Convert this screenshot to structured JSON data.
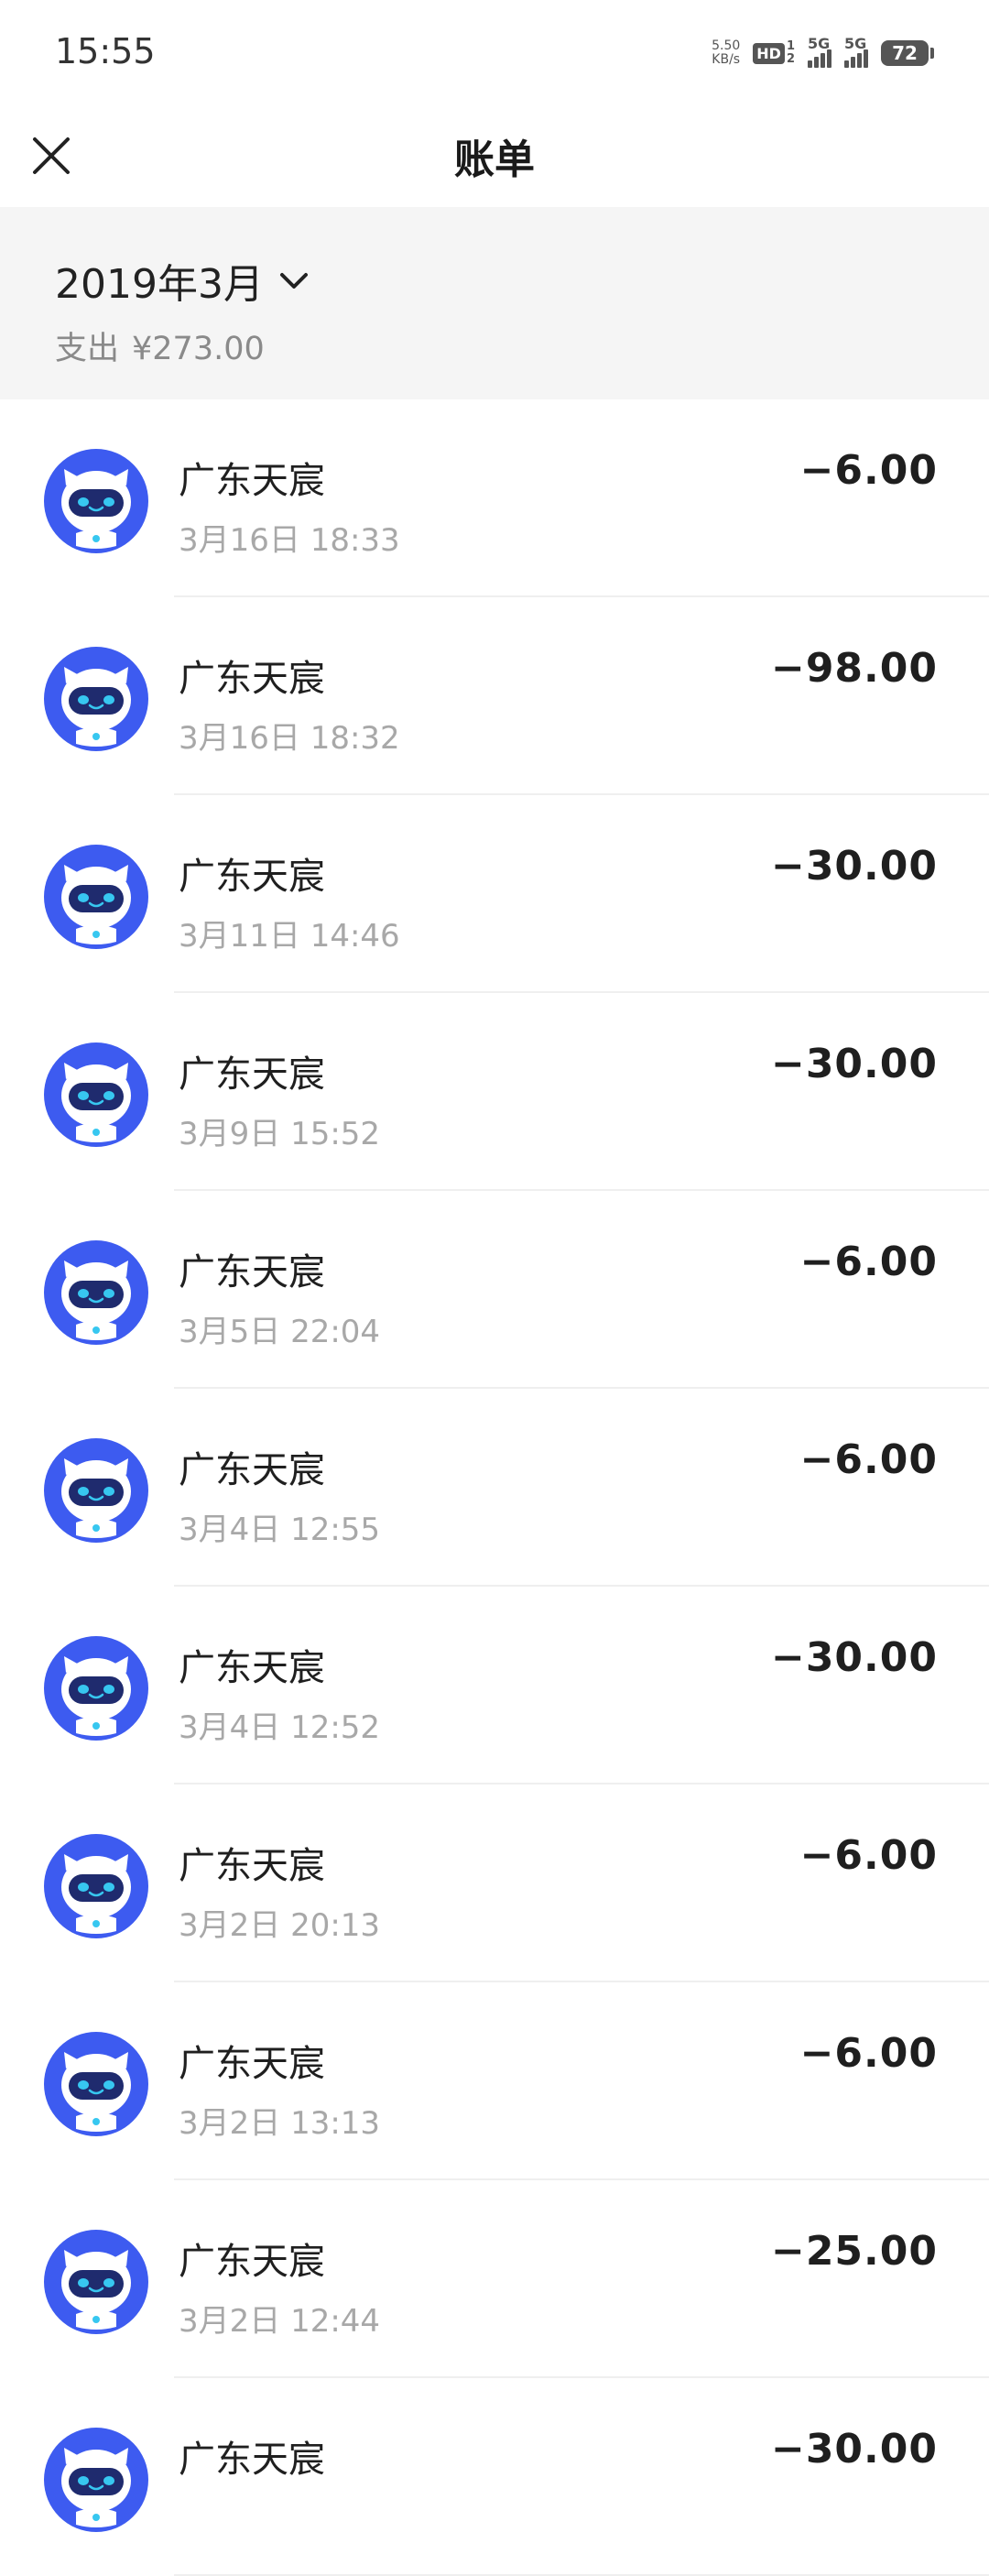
{
  "status_bar": {
    "time": "15:55",
    "net_speed_value": "5.50",
    "net_speed_unit": "KB/s",
    "hd_label": "HD",
    "hd_sub_top": "1",
    "hd_sub_bottom": "2",
    "signal1_label": "5G",
    "signal2_label": "5G",
    "battery": "72"
  },
  "nav": {
    "title": "账单",
    "close_icon": "close-icon"
  },
  "summary": {
    "month": "2019年3月",
    "spend_label": "支出",
    "spend_amount": "¥273.00"
  },
  "colors": {
    "avatar_blue": "#3d5bf0",
    "header_bg": "#f5f5f5",
    "secondary_text": "#a8a8a8"
  },
  "transactions": [
    {
      "merchant": "广东天宸",
      "time": "3月16日 18:33",
      "amount": "−6.00"
    },
    {
      "merchant": "广东天宸",
      "time": "3月16日 18:32",
      "amount": "−98.00"
    },
    {
      "merchant": "广东天宸",
      "time": "3月11日 14:46",
      "amount": "−30.00"
    },
    {
      "merchant": "广东天宸",
      "time": "3月9日 15:52",
      "amount": "−30.00"
    },
    {
      "merchant": "广东天宸",
      "time": "3月5日 22:04",
      "amount": "−6.00"
    },
    {
      "merchant": "广东天宸",
      "time": "3月4日 12:55",
      "amount": "−6.00"
    },
    {
      "merchant": "广东天宸",
      "time": "3月4日 12:52",
      "amount": "−30.00"
    },
    {
      "merchant": "广东天宸",
      "time": "3月2日 20:13",
      "amount": "−6.00"
    },
    {
      "merchant": "广东天宸",
      "time": "3月2日 13:13",
      "amount": "−6.00"
    },
    {
      "merchant": "广东天宸",
      "time": "3月2日 12:44",
      "amount": "−25.00"
    },
    {
      "merchant": "广东天宸",
      "time": "",
      "amount": "−30.00"
    }
  ]
}
